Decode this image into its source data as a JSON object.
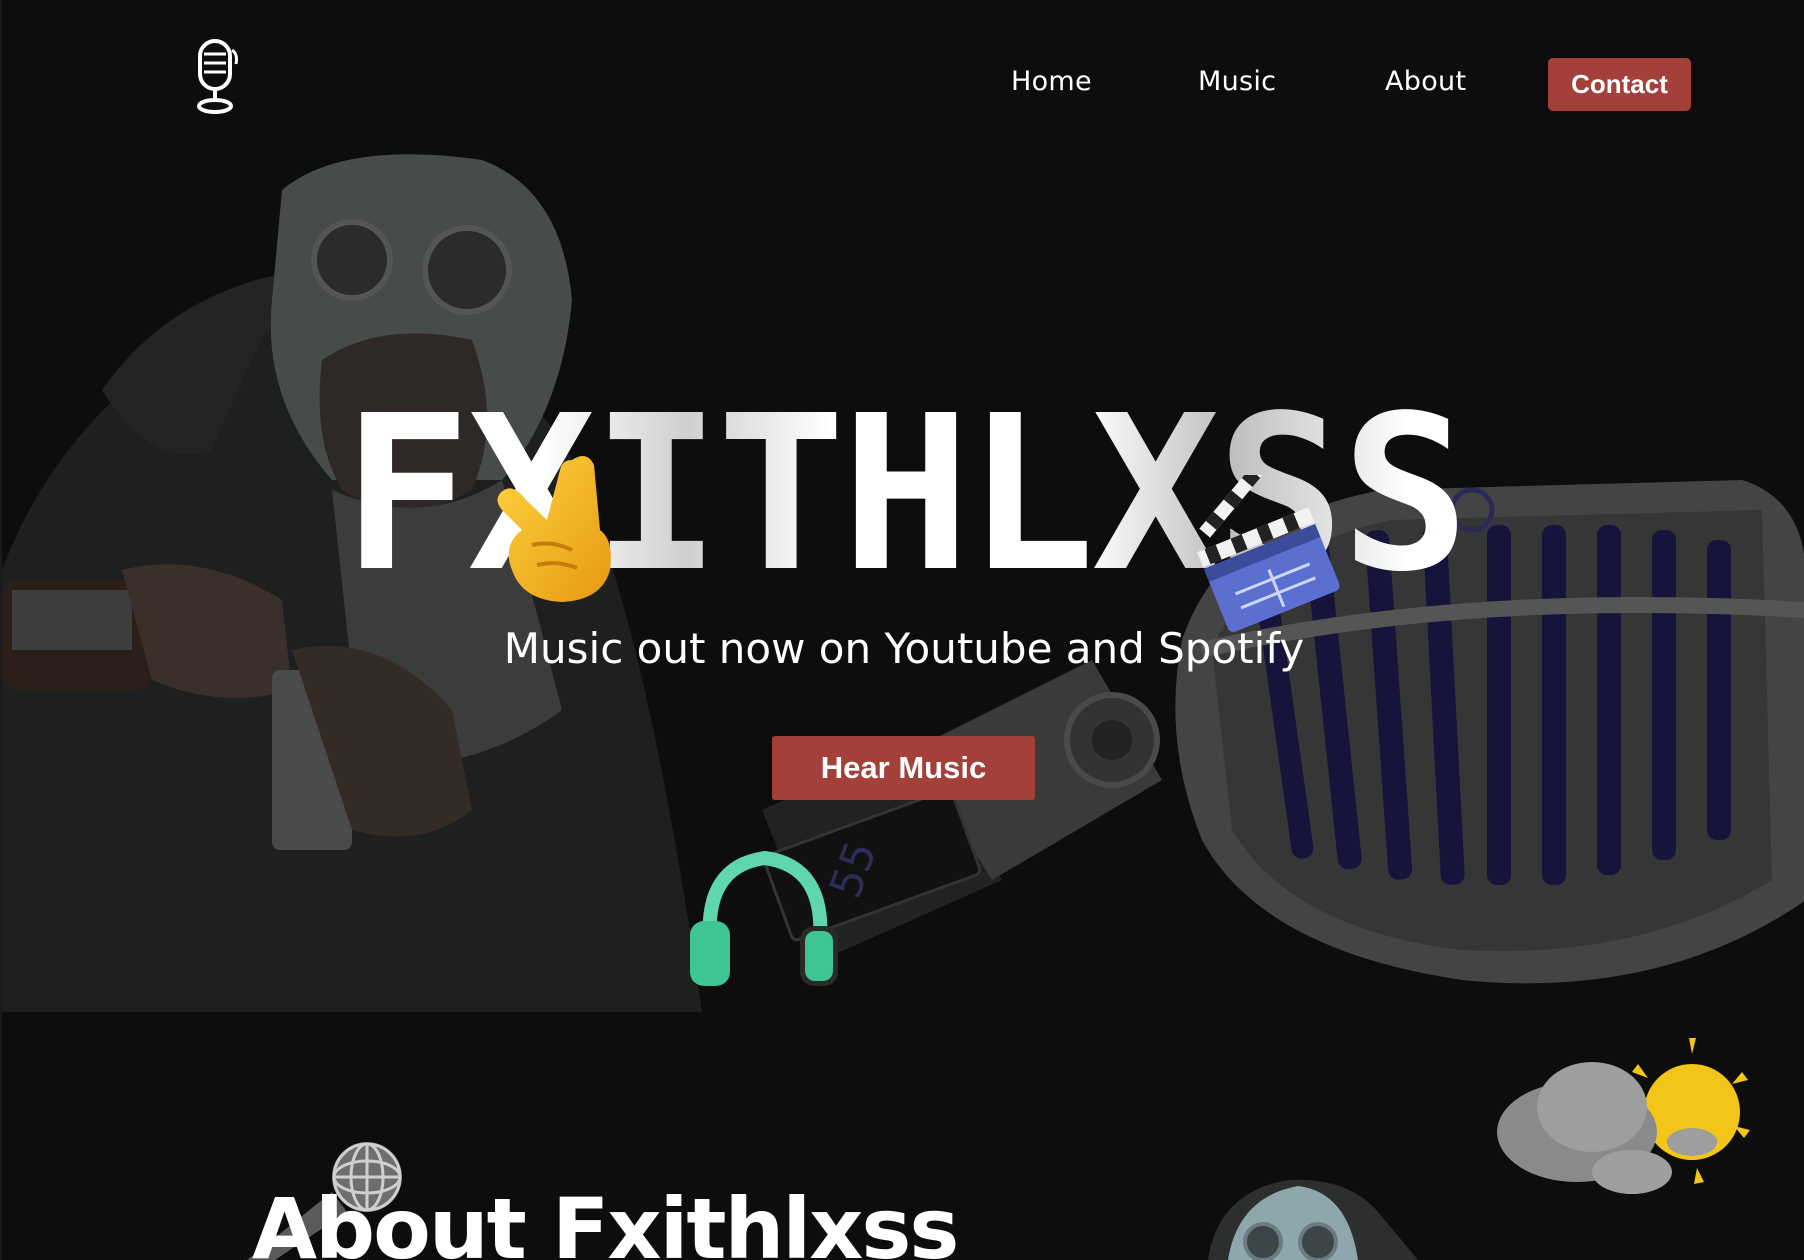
{
  "nav": {
    "logo_icon": "microphone-icon",
    "links": [
      {
        "label": "Home"
      },
      {
        "label": "Music"
      },
      {
        "label": "About"
      }
    ],
    "contact_label": "Contact"
  },
  "hero": {
    "title": "FXITHLXSS",
    "subtitle": "Music out now on Youtube and Spotify",
    "button_label": "Hear Music",
    "emojis": [
      "rock-hand-icon",
      "clapperboard-icon",
      "headphones-icon"
    ]
  },
  "about": {
    "title": "About Fxithlxss",
    "decorations": [
      "microphone-icon",
      "sun-behind-cloud-icon"
    ]
  },
  "colors": {
    "background": "#0d0d0d",
    "accent": "#a3403a",
    "text": "#ffffff"
  }
}
